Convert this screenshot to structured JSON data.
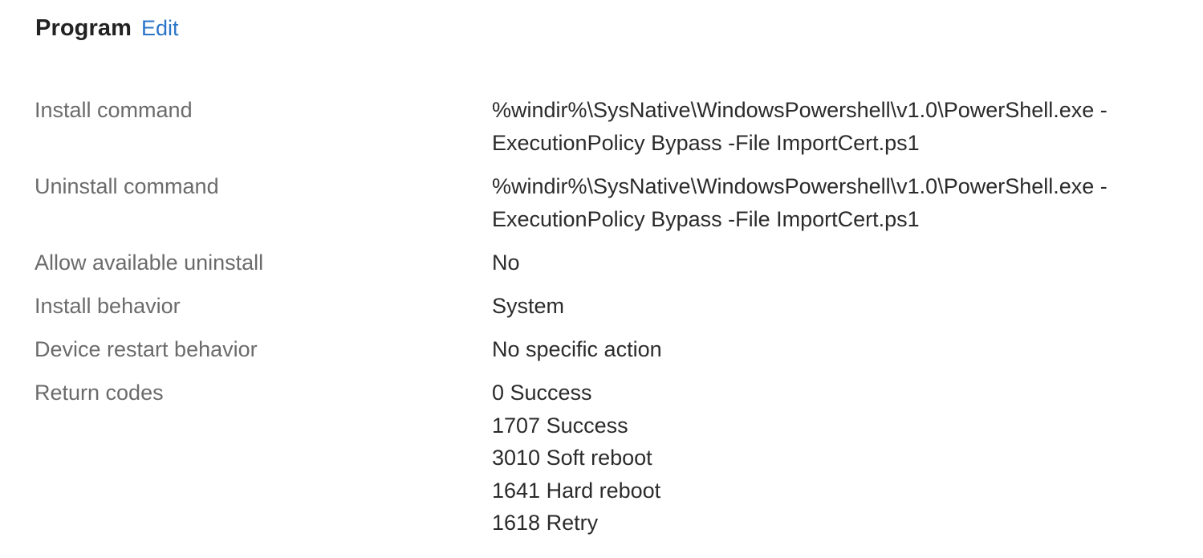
{
  "header": {
    "title": "Program",
    "edit_label": "Edit"
  },
  "properties": {
    "install_command": {
      "label": "Install command",
      "value_line1": "%windir%\\SysNative\\WindowsPowershell\\v1.0\\PowerShell.exe -",
      "value_line2": "ExecutionPolicy Bypass -File ImportCert.ps1"
    },
    "uninstall_command": {
      "label": "Uninstall command",
      "value_line1": "%windir%\\SysNative\\WindowsPowershell\\v1.0\\PowerShell.exe -",
      "value_line2": "ExecutionPolicy Bypass -File ImportCert.ps1"
    },
    "allow_available_uninstall": {
      "label": "Allow available uninstall",
      "value": "No"
    },
    "install_behavior": {
      "label": "Install behavior",
      "value": "System"
    },
    "device_restart_behavior": {
      "label": "Device restart behavior",
      "value": "No specific action"
    },
    "return_codes": {
      "label": "Return codes",
      "codes": [
        "0 Success",
        "1707 Success",
        "3010 Soft reboot",
        "1641 Hard reboot",
        "1618 Retry"
      ]
    }
  },
  "colors": {
    "link": "#2a74c8",
    "label": "#6b6b6b",
    "value": "#2b2b2b",
    "title": "#222222"
  }
}
